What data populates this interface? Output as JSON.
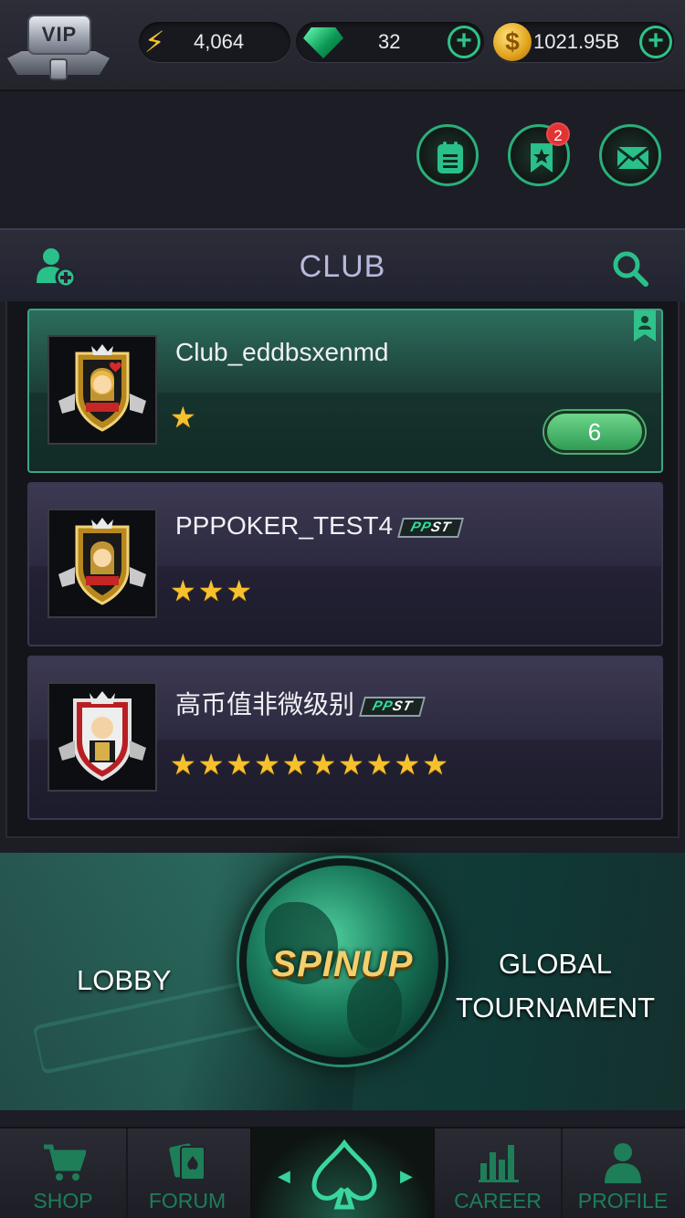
{
  "topbar": {
    "vip_label": "VIP",
    "energy": "4,064",
    "gems": "32",
    "coins": "1021.95B",
    "plus": "+"
  },
  "actions": {
    "notifications_badge": "2"
  },
  "club_header": {
    "title": "CLUB"
  },
  "clubs": [
    {
      "name": "Club_eddbsxenmd",
      "stars": "★",
      "count": "6",
      "ppst": false
    },
    {
      "name": "PPPOKER_TEST4",
      "stars": "★★★",
      "ppst": true
    },
    {
      "name": "高币值非微级别",
      "stars": "★★★★★★★★★★",
      "ppst": true
    }
  ],
  "ppst": {
    "pp": "PP",
    "st": "ST"
  },
  "banner": {
    "lobby": "LOBBY",
    "spinup": "SPINUP",
    "global_line1": "GLOBAL",
    "global_line2": "TOURNAMENT"
  },
  "nav": {
    "shop": "SHOP",
    "forum": "FORUM",
    "career": "CAREER",
    "profile": "PROFILE"
  },
  "colors": {
    "accent": "#2fc28a",
    "background": "#1c1d25",
    "star": "#f7c12d",
    "badge": "#e23232"
  }
}
